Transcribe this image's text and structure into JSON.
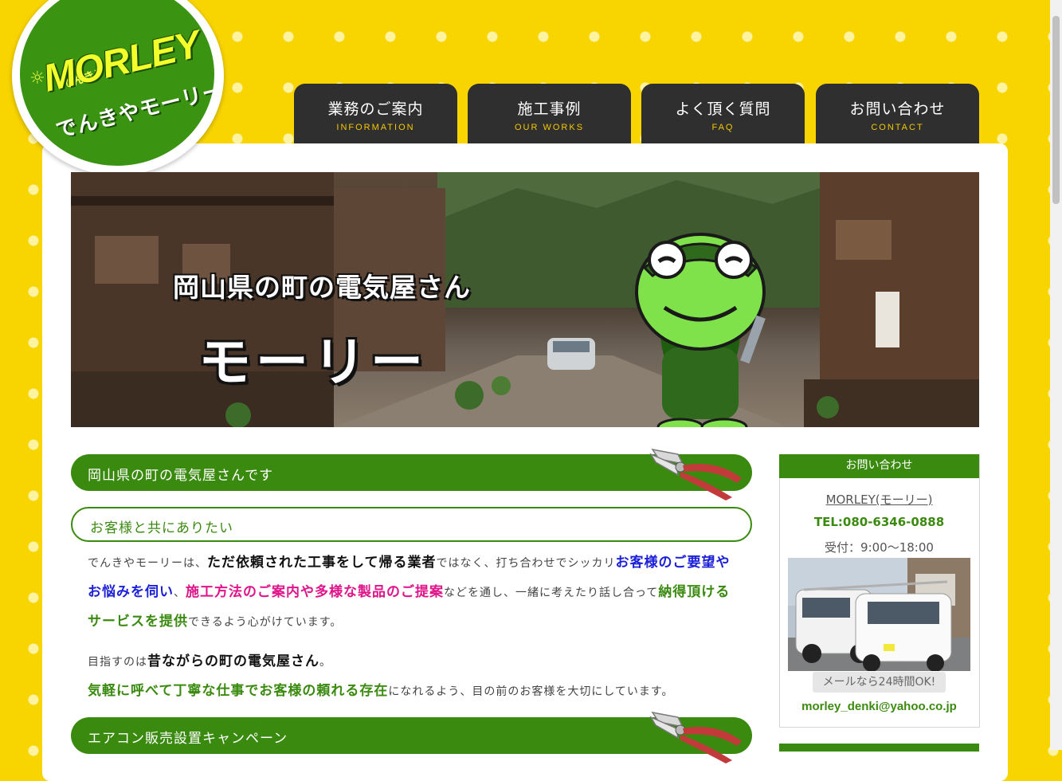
{
  "logo": {
    "sub": "でんきや",
    "main": "MORLEY",
    "tagline": "でんきやモーリー"
  },
  "nav": [
    {
      "jp": "業務のご案内",
      "en": "INFORMATION"
    },
    {
      "jp": "施工事例",
      "en": "OUR WORKS"
    },
    {
      "jp": "よく頂く質問",
      "en": "FAQ"
    },
    {
      "jp": "お問い合わせ",
      "en": "CONTACT"
    }
  ],
  "hero": {
    "line1": "岡山県の町の電気屋さん",
    "line2": "モーリー"
  },
  "main": {
    "section1_title": "岡山県の町の電気屋さんです",
    "subheading": "お客様と共にありたい",
    "p1": [
      "でんきやモーリーは、",
      "ただ依頼された工事をして帰る業者",
      "ではなく、打ち合わせでシッカリ",
      "お客様のご要望やお悩みを伺い",
      "、",
      "施工方法のご案内や多様な製品のご提案",
      "などを通し、一緒に考えたり話し合って",
      "納得頂けるサービスを提供",
      "できるよう心がけています。"
    ],
    "p2": [
      "目指すのは",
      "昔ながらの町の電気屋さん",
      "。"
    ],
    "p3": [
      "気軽に呼べて丁寧な仕事でお客様の頼れる存在",
      "になれるよう、目の前のお客様を大切にしています。"
    ],
    "section2_title": "エアコン販売設置キャンペーン"
  },
  "sidebar": {
    "title": "お問い合わせ",
    "company": "MORLEY(モーリー)",
    "tel": "TEL:080-6346-0888",
    "hours": "受付：9:00〜18:00",
    "mail_label": "メールなら24時間OK!",
    "email": "morley_denki@yahoo.co.jp"
  },
  "colors": {
    "brand_green": "#3b8a10",
    "background_yellow": "#f8d400",
    "nav_dark": "#2f2f2f",
    "nav_accent": "#f6c800"
  },
  "icons": [
    "pliers-icon",
    "light-bulb-icon",
    "frog-mascot"
  ]
}
